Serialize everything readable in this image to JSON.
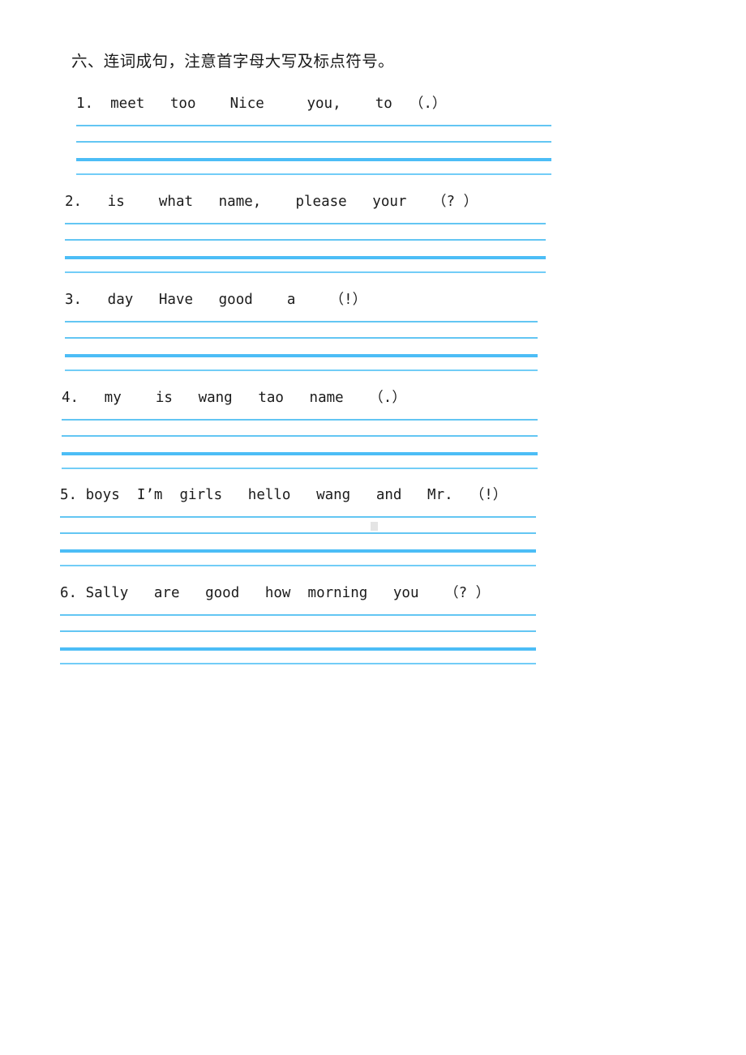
{
  "worksheet": {
    "section_heading": "六、连词成句，注意首字母大写及标点符号。",
    "questions": [
      {
        "number": "1.",
        "text": "1.  meet   too    Nice     you,    to  （.）",
        "words": [
          "meet",
          "too",
          "Nice",
          "you,",
          "to"
        ],
        "punctuation": "（.）"
      },
      {
        "number": "2.",
        "text": "2.   is    what   name,    please   your   （? ）",
        "words": [
          "is",
          "what",
          "name,",
          "please",
          "your"
        ],
        "punctuation": "（? ）"
      },
      {
        "number": "3.",
        "text": "3.   day   Have   good    a    （!）",
        "words": [
          "day",
          "Have",
          "good",
          "a"
        ],
        "punctuation": "（!）"
      },
      {
        "number": "4.",
        "text": "4.   my    is   wang   tao   name   （.）",
        "words": [
          "my",
          "is",
          "wang",
          "tao",
          "name"
        ],
        "punctuation": "（.）"
      },
      {
        "number": "5.",
        "text": "5. boys  I’m  girls   hello   wang   and   Mr.  （!）",
        "words": [
          "boys",
          "I’m",
          "girls",
          "hello",
          "wang",
          "and",
          "Mr."
        ],
        "punctuation": "（!）"
      },
      {
        "number": "6.",
        "text": "6. Sally   are   good   how  morning   you   （? ）",
        "words": [
          "Sally",
          "are",
          "good",
          "how",
          "morning",
          "you"
        ],
        "punctuation": "（? ）"
      }
    ],
    "ruler": {
      "line_count": 4,
      "color": "#55c2f5"
    }
  }
}
